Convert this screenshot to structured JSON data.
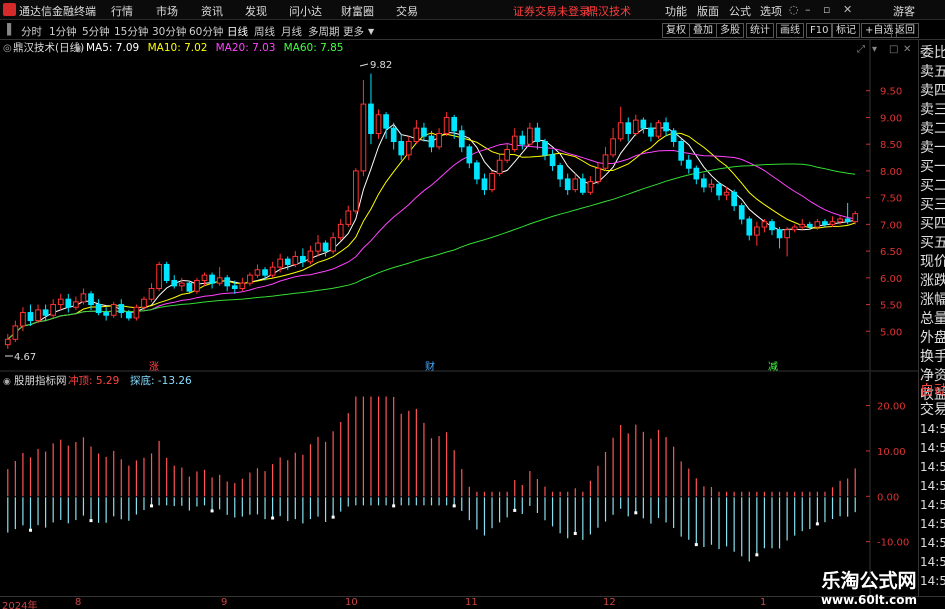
{
  "menubar": {
    "app_title": "通达信金融终端",
    "menus": [
      "行情",
      "市场",
      "资讯",
      "发现",
      "问小达",
      "财富圈",
      "交易"
    ],
    "status_warning": "证券交易未登录",
    "status_name": "鼎汉技术",
    "right_items": [
      "功能",
      "版面",
      "公式",
      "选项"
    ],
    "guest": "游客"
  },
  "periodbar": {
    "periods": [
      "分时",
      "1分钟",
      "5分钟",
      "15分钟",
      "30分钟",
      "60分钟",
      "日线",
      "周线",
      "月线",
      "多周期",
      "更多"
    ],
    "active": "日线",
    "buttons": [
      "复权",
      "叠加",
      "多股",
      "统计",
      "画线",
      "F10",
      "标记",
      "+自选",
      "返回"
    ]
  },
  "main_chart": {
    "stock_label": "鼎汉技术(日线)",
    "ma_legend": [
      {
        "name": "MA5",
        "value": "7.09",
        "color": "#ffffff"
      },
      {
        "name": "MA10",
        "value": "7.02",
        "color": "#ffff00"
      },
      {
        "name": "MA20",
        "value": "7.03",
        "color": "#ff44ff"
      },
      {
        "name": "MA60",
        "value": "7.85",
        "color": "#44ff44"
      }
    ],
    "high_label": "9.82",
    "low_label": "4.67",
    "y_ticks": [
      "9.50",
      "9.00",
      "8.50",
      "8.00",
      "7.50",
      "7.00",
      "6.50",
      "6.00",
      "5.50",
      "5.00"
    ],
    "event_markers": [
      {
        "text": "涨",
        "color": "#ff4444"
      },
      {
        "text": "财",
        "color": "#44aaff"
      },
      {
        "text": "减",
        "color": "#44ff44"
      }
    ],
    "colors": {
      "up": "#ff3333",
      "down": "#00e5ff"
    }
  },
  "indicator_chart": {
    "name": "股朋指标网",
    "labels": [
      {
        "name": "冲顶",
        "value": "5.29",
        "color": "#ff4444"
      },
      {
        "name": "探底",
        "value": "-13.26",
        "color": "#88ddff"
      }
    ],
    "y_ticks": [
      "20.00",
      "10.00",
      "0.00",
      "-10.00"
    ]
  },
  "x_axis": {
    "labels": [
      "2024年",
      "8",
      "9",
      "10",
      "11",
      "12",
      "1"
    ]
  },
  "side_panel": {
    "items": [
      "委比",
      "卖五",
      "卖四",
      "卖三",
      "卖二",
      "卖一",
      "买一",
      "买二",
      "买三",
      "买四",
      "买五",
      "现价",
      "涨跌",
      "涨幅",
      "总量",
      "外盘",
      "换手",
      "净资",
      "收益"
    ],
    "lower_items": [
      "自动",
      "交易"
    ],
    "times": [
      "14:56",
      "14:56",
      "14:56",
      "14:56",
      "14:56",
      "14:56",
      "14:56",
      "14:56",
      "14:5"
    ]
  },
  "watermark": {
    "title": "乐淘公式网",
    "url": "www.60lt.com"
  },
  "chart_data": {
    "type": "candlestick",
    "y_range": [
      4.5,
      10.0
    ],
    "candles": [
      [
        4.75,
        4.85,
        4.67,
        4.95
      ],
      [
        4.85,
        5.1,
        4.8,
        5.2
      ],
      [
        5.1,
        5.35,
        5.0,
        5.45
      ],
      [
        5.35,
        5.2,
        5.1,
        5.5
      ],
      [
        5.2,
        5.4,
        5.15,
        5.5
      ],
      [
        5.4,
        5.3,
        5.2,
        5.5
      ],
      [
        5.3,
        5.5,
        5.25,
        5.6
      ],
      [
        5.5,
        5.6,
        5.4,
        5.7
      ],
      [
        5.6,
        5.45,
        5.35,
        5.7
      ],
      [
        5.45,
        5.55,
        5.4,
        5.65
      ],
      [
        5.55,
        5.7,
        5.5,
        5.8
      ],
      [
        5.7,
        5.5,
        5.4,
        5.75
      ],
      [
        5.5,
        5.35,
        5.3,
        5.6
      ],
      [
        5.35,
        5.3,
        5.2,
        5.45
      ],
      [
        5.3,
        5.5,
        5.25,
        5.55
      ],
      [
        5.5,
        5.35,
        5.25,
        5.6
      ],
      [
        5.35,
        5.25,
        5.2,
        5.4
      ],
      [
        5.25,
        5.45,
        5.2,
        5.5
      ],
      [
        5.45,
        5.6,
        5.4,
        5.65
      ],
      [
        5.6,
        5.8,
        5.55,
        5.9
      ],
      [
        5.8,
        6.25,
        5.75,
        6.3
      ],
      [
        6.25,
        5.95,
        5.9,
        6.3
      ],
      [
        5.95,
        5.85,
        5.8,
        6.05
      ],
      [
        5.85,
        5.9,
        5.75,
        6.0
      ],
      [
        5.9,
        5.75,
        5.7,
        5.95
      ],
      [
        5.75,
        5.95,
        5.7,
        6.0
      ],
      [
        5.95,
        6.05,
        5.85,
        6.1
      ],
      [
        6.05,
        5.9,
        5.8,
        6.1
      ],
      [
        5.9,
        6.0,
        5.85,
        6.2
      ],
      [
        6.0,
        5.85,
        5.75,
        6.05
      ],
      [
        5.85,
        5.8,
        5.7,
        5.95
      ],
      [
        5.8,
        5.9,
        5.75,
        6.0
      ],
      [
        5.9,
        6.05,
        5.85,
        6.1
      ],
      [
        6.05,
        6.15,
        6.0,
        6.25
      ],
      [
        6.15,
        6.05,
        5.95,
        6.2
      ],
      [
        6.05,
        6.2,
        6.0,
        6.3
      ],
      [
        6.2,
        6.35,
        6.1,
        6.45
      ],
      [
        6.35,
        6.25,
        6.15,
        6.4
      ],
      [
        6.25,
        6.4,
        6.2,
        6.5
      ],
      [
        6.4,
        6.3,
        6.2,
        6.55
      ],
      [
        6.3,
        6.5,
        6.25,
        6.6
      ],
      [
        6.5,
        6.65,
        6.4,
        6.8
      ],
      [
        6.65,
        6.5,
        6.4,
        6.7
      ],
      [
        6.5,
        6.75,
        6.45,
        6.85
      ],
      [
        6.75,
        7.0,
        6.7,
        7.1
      ],
      [
        7.0,
        7.25,
        6.95,
        7.35
      ],
      [
        7.25,
        8.0,
        7.2,
        8.05
      ],
      [
        8.0,
        9.25,
        7.9,
        9.7
      ],
      [
        9.25,
        8.7,
        8.5,
        9.82
      ],
      [
        8.7,
        9.05,
        8.6,
        9.15
      ],
      [
        9.05,
        8.8,
        8.6,
        9.1
      ],
      [
        8.8,
        8.55,
        8.4,
        8.9
      ],
      [
        8.55,
        8.3,
        8.2,
        8.7
      ],
      [
        8.3,
        8.55,
        8.2,
        8.65
      ],
      [
        8.55,
        8.8,
        8.5,
        8.95
      ],
      [
        8.8,
        8.65,
        8.55,
        8.9
      ],
      [
        8.65,
        8.45,
        8.35,
        8.75
      ],
      [
        8.45,
        8.7,
        8.4,
        8.8
      ],
      [
        8.7,
        9.0,
        8.65,
        9.1
      ],
      [
        9.0,
        8.75,
        8.6,
        9.05
      ],
      [
        8.75,
        8.45,
        8.35,
        8.85
      ],
      [
        8.45,
        8.15,
        8.05,
        8.5
      ],
      [
        8.15,
        7.85,
        7.75,
        8.2
      ],
      [
        7.85,
        7.65,
        7.55,
        7.95
      ],
      [
        7.65,
        7.95,
        7.6,
        8.0
      ],
      [
        7.95,
        8.2,
        7.9,
        8.3
      ],
      [
        8.2,
        8.4,
        8.15,
        8.5
      ],
      [
        8.4,
        8.65,
        8.35,
        8.8
      ],
      [
        8.65,
        8.5,
        8.4,
        8.75
      ],
      [
        8.5,
        8.8,
        8.45,
        8.9
      ],
      [
        8.8,
        8.55,
        8.4,
        8.9
      ],
      [
        8.55,
        8.3,
        8.2,
        8.6
      ],
      [
        8.3,
        8.1,
        8.0,
        8.4
      ],
      [
        8.1,
        7.85,
        7.7,
        8.15
      ],
      [
        7.85,
        7.65,
        7.55,
        7.95
      ],
      [
        7.65,
        7.85,
        7.6,
        7.95
      ],
      [
        7.85,
        7.6,
        7.55,
        7.95
      ],
      [
        7.6,
        7.8,
        7.55,
        7.9
      ],
      [
        7.8,
        8.05,
        7.75,
        8.15
      ],
      [
        8.05,
        8.3,
        8.0,
        8.45
      ],
      [
        8.3,
        8.6,
        8.25,
        8.8
      ],
      [
        8.6,
        8.9,
        8.55,
        9.2
      ],
      [
        8.9,
        8.7,
        8.55,
        9.0
      ],
      [
        8.7,
        8.95,
        8.65,
        9.05
      ],
      [
        8.95,
        8.8,
        8.7,
        9.0
      ],
      [
        8.8,
        8.65,
        8.55,
        8.9
      ],
      [
        8.65,
        8.9,
        8.6,
        8.95
      ],
      [
        8.9,
        8.75,
        8.65,
        9.0
      ],
      [
        8.75,
        8.55,
        8.45,
        8.8
      ],
      [
        8.55,
        8.2,
        8.1,
        8.6
      ],
      [
        8.2,
        8.05,
        7.95,
        8.3
      ],
      [
        8.05,
        7.85,
        7.75,
        8.1
      ],
      [
        7.85,
        7.7,
        7.6,
        7.95
      ],
      [
        7.7,
        7.75,
        7.6,
        7.85
      ],
      [
        7.75,
        7.55,
        7.45,
        7.8
      ],
      [
        7.55,
        7.6,
        7.45,
        7.7
      ],
      [
        7.6,
        7.35,
        7.25,
        7.65
      ],
      [
        7.35,
        7.1,
        7.0,
        7.4
      ],
      [
        7.1,
        6.8,
        6.7,
        7.15
      ],
      [
        6.8,
        6.95,
        6.6,
        7.05
      ],
      [
        6.95,
        7.05,
        6.85,
        7.1
      ],
      [
        7.05,
        6.9,
        6.8,
        7.1
      ],
      [
        6.9,
        6.75,
        6.55,
        6.95
      ],
      [
        6.75,
        6.9,
        6.4,
        6.95
      ],
      [
        6.9,
        6.95,
        6.85,
        7.0
      ],
      [
        6.95,
        7.0,
        6.9,
        7.1
      ],
      [
        7.0,
        6.95,
        6.9,
        7.05
      ],
      [
        6.95,
        7.05,
        6.9,
        7.1
      ],
      [
        7.05,
        7.0,
        6.95,
        7.1
      ],
      [
        7.0,
        7.05,
        6.95,
        7.15
      ],
      [
        7.05,
        7.1,
        7.0,
        7.15
      ],
      [
        7.1,
        7.05,
        7.0,
        7.4
      ],
      [
        7.05,
        7.2,
        7.0,
        7.25
      ]
    ]
  }
}
